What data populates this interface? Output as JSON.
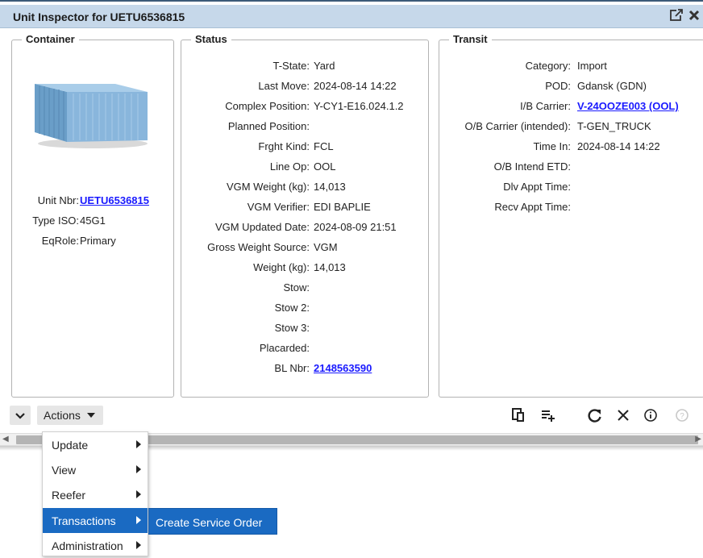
{
  "window": {
    "title": "Unit Inspector for UETU6536815"
  },
  "container": {
    "legend": "Container",
    "fields": [
      {
        "label": "Unit Nbr:",
        "value": "UETU6536815",
        "link": true
      },
      {
        "label": "Type ISO:",
        "value": "45G1",
        "link": false
      },
      {
        "label": "EqRole:",
        "value": "Primary",
        "link": false
      }
    ],
    "image_icon": "shipping-container-image"
  },
  "status": {
    "legend": "Status",
    "fields": [
      {
        "label": "T-State:",
        "value": "Yard"
      },
      {
        "label": "Last Move:",
        "value": "2024-08-14 14:22"
      },
      {
        "label": "Complex Position:",
        "value": "Y-CY1-E16.024.1.2"
      },
      {
        "label": "Planned Position:",
        "value": ""
      },
      {
        "label": "Frght Kind:",
        "value": "FCL"
      },
      {
        "label": "Line Op:",
        "value": "OOL"
      },
      {
        "label": "VGM Weight (kg):",
        "value": "14,013"
      },
      {
        "label": "VGM Verifier:",
        "value": "EDI BAPLIE"
      },
      {
        "label": "VGM Updated Date:",
        "value": "2024-08-09 21:51"
      },
      {
        "label": "Gross Weight Source:",
        "value": "VGM"
      },
      {
        "label": "Weight (kg):",
        "value": "14,013"
      },
      {
        "label": "Stow:",
        "value": ""
      },
      {
        "label": "Stow 2:",
        "value": ""
      },
      {
        "label": "Stow 3:",
        "value": ""
      },
      {
        "label": "Placarded:",
        "value": ""
      },
      {
        "label": "BL Nbr:",
        "value": "2148563590",
        "link": true
      }
    ]
  },
  "transit": {
    "legend": "Transit",
    "fields": [
      {
        "label": "Category:",
        "value": "Import"
      },
      {
        "label": "POD:",
        "value": "Gdansk (GDN)"
      },
      {
        "label": "I/B Carrier:",
        "value": "V-24OOZE003 (OOL)",
        "link": true
      },
      {
        "label": "O/B Carrier (intended):",
        "value": "T-GEN_TRUCK"
      },
      {
        "label": "Time In:",
        "value": "2024-08-14 14:22"
      },
      {
        "label": "O/B Intend ETD:",
        "value": ""
      },
      {
        "label": "Dlv Appt Time:",
        "value": ""
      },
      {
        "label": "Recv Appt Time:",
        "value": ""
      }
    ]
  },
  "toolbar": {
    "actions_label": "Actions",
    "icons": [
      "copy-icon",
      "add-list-icon",
      "refresh-icon",
      "close-icon",
      "info-icon",
      "help-icon"
    ]
  },
  "menu": {
    "items": [
      {
        "label": "Update",
        "active": false
      },
      {
        "label": "View",
        "active": false
      },
      {
        "label": "Reefer",
        "active": false
      },
      {
        "label": "Transactions",
        "active": true
      },
      {
        "label": "Administration",
        "active": false
      }
    ],
    "submenu": {
      "label": "Create Service Order"
    }
  },
  "colors": {
    "titlebar": "#c6d8ea",
    "link": "#1a1aff",
    "menu_active": "#1a6ac2"
  }
}
